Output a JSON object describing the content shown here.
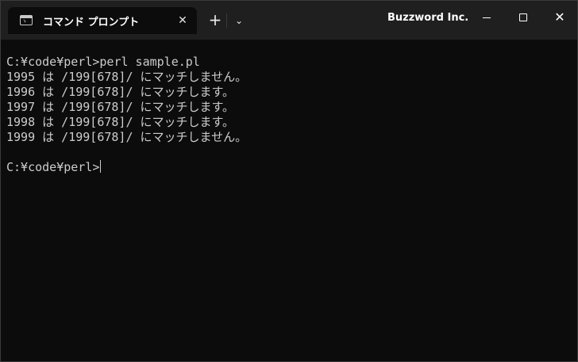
{
  "titlebar": {
    "tab_title": "コマンド プロンプト",
    "tab_close_glyph": "✕",
    "new_tab_glyph": "+",
    "dropdown_glyph": "⌄",
    "organization": "Buzzword Inc.",
    "close_glyph": "✕"
  },
  "terminal": {
    "lines": [
      "C:¥code¥perl>perl sample.pl",
      "1995 は /199[678]/ にマッチしません。",
      "1996 は /199[678]/ にマッチします。",
      "1997 は /199[678]/ にマッチします。",
      "1998 は /199[678]/ にマッチします。",
      "1999 は /199[678]/ にマッチしません。",
      "",
      "C:¥code¥perl>"
    ]
  },
  "colors": {
    "background": "#0c0c0c",
    "titlebar": "#1f1f1f",
    "text": "#cccccc"
  },
  "icons": [
    "terminal-app-icon",
    "close-icon",
    "plus-icon",
    "chevron-down-icon",
    "minimize-icon",
    "maximize-icon",
    "window-close-icon"
  ]
}
